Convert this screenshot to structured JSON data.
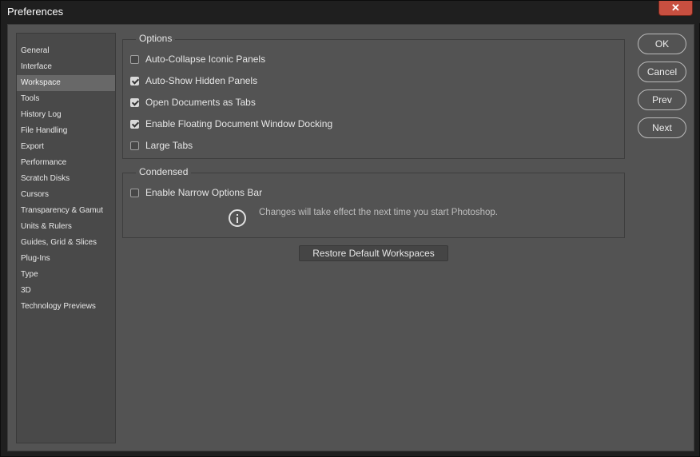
{
  "window": {
    "title": "Preferences",
    "close_glyph": "✕"
  },
  "sidebar": {
    "items": [
      {
        "label": "General"
      },
      {
        "label": "Interface"
      },
      {
        "label": "Workspace",
        "active": true
      },
      {
        "label": "Tools"
      },
      {
        "label": "History Log"
      },
      {
        "label": "File Handling"
      },
      {
        "label": "Export"
      },
      {
        "label": "Performance"
      },
      {
        "label": "Scratch Disks"
      },
      {
        "label": "Cursors"
      },
      {
        "label": "Transparency & Gamut"
      },
      {
        "label": "Units & Rulers"
      },
      {
        "label": "Guides, Grid & Slices"
      },
      {
        "label": "Plug-Ins"
      },
      {
        "label": "Type"
      },
      {
        "label": "3D"
      },
      {
        "label": "Technology Previews"
      }
    ]
  },
  "options": {
    "title": "Options",
    "items": [
      {
        "label": "Auto-Collapse Iconic Panels",
        "checked": false
      },
      {
        "label": "Auto-Show Hidden Panels",
        "checked": true
      },
      {
        "label": "Open Documents as Tabs",
        "checked": true
      },
      {
        "label": "Enable Floating Document Window Docking",
        "checked": true
      },
      {
        "label": "Large Tabs",
        "checked": false
      }
    ]
  },
  "condensed": {
    "title": "Condensed",
    "narrow_label": "Enable Narrow Options Bar",
    "narrow_checked": false,
    "info_text": "Changes will take effect the next time you start Photoshop."
  },
  "restore_label": "Restore Default Workspaces",
  "buttons": {
    "ok": "OK",
    "cancel": "Cancel",
    "prev": "Prev",
    "next": "Next"
  }
}
